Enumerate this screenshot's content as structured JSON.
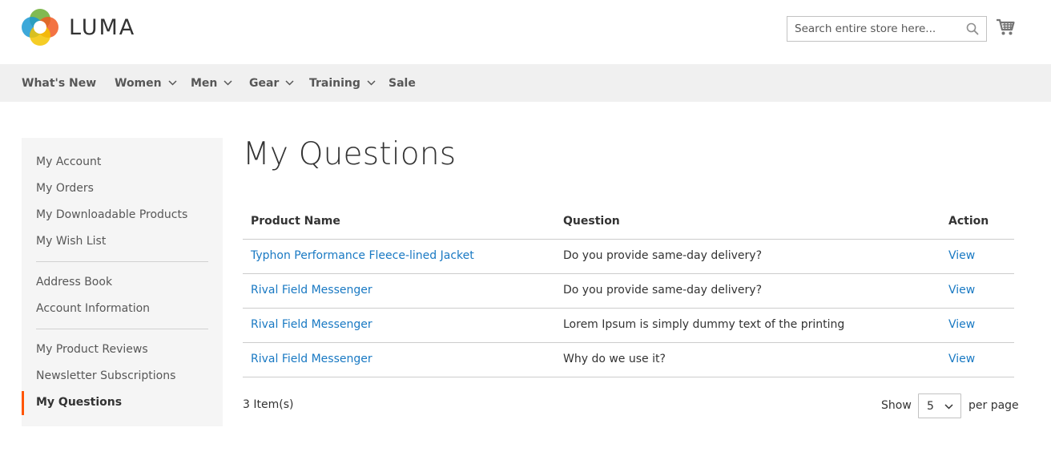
{
  "brand": {
    "name": "LUMA"
  },
  "search": {
    "placeholder": "Search entire store here..."
  },
  "icons": {
    "logo": "luma-logo",
    "search": "search-icon",
    "cart": "cart-icon",
    "chevron": "chevron-down-icon"
  },
  "nav": {
    "items": [
      {
        "label": "What's New",
        "has_dropdown": false
      },
      {
        "label": "Women",
        "has_dropdown": true
      },
      {
        "label": "Men",
        "has_dropdown": true
      },
      {
        "label": "Gear",
        "has_dropdown": true
      },
      {
        "label": "Training",
        "has_dropdown": true
      },
      {
        "label": "Sale",
        "has_dropdown": false
      }
    ]
  },
  "sidebar": {
    "items": [
      {
        "label": "My Account"
      },
      {
        "label": "My Orders"
      },
      {
        "label": "My Downloadable Products"
      },
      {
        "label": "My Wish List"
      },
      {
        "label": "Address Book"
      },
      {
        "label": "Account Information"
      },
      {
        "label": "My Product Reviews"
      },
      {
        "label": "Newsletter Subscriptions"
      },
      {
        "label": "My Questions",
        "active": true
      }
    ]
  },
  "page": {
    "title": "My Questions"
  },
  "table": {
    "headers": [
      "Product Name",
      "Question",
      "Action"
    ],
    "rows": [
      {
        "product": "Typhon Performance Fleece-lined Jacket",
        "question": "Do you provide same-day delivery?",
        "action": "View"
      },
      {
        "product": "Rival Field Messenger",
        "question": "Do you provide same-day delivery?",
        "action": "View"
      },
      {
        "product": "Rival Field Messenger",
        "question": "Lorem Ipsum is simply dummy text of the printing",
        "action": "View"
      },
      {
        "product": "Rival Field Messenger",
        "question": "Why do we use it?",
        "action": "View"
      }
    ]
  },
  "toolbar": {
    "items_count": "3 Item(s)",
    "show_label": "Show",
    "limiter_value": "5",
    "per_page_label": "per page"
  },
  "colors": {
    "link": "#1979c3",
    "active_accent": "#ff5501",
    "nav_bg": "#f0f0f0",
    "sidebar_bg": "#f5f5f5"
  }
}
